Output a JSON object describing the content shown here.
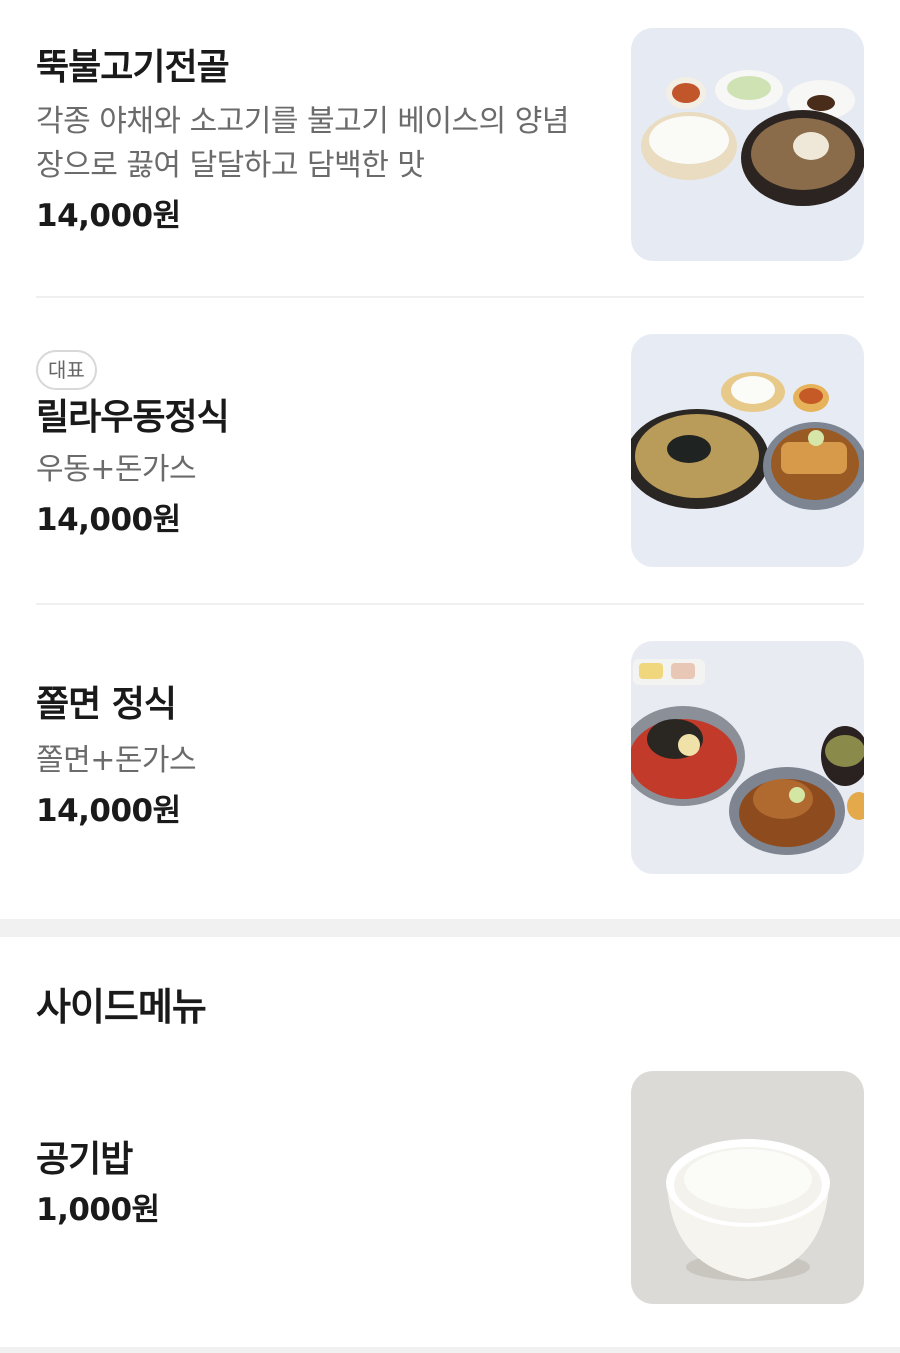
{
  "items": [
    {
      "name": "뚝불고기전골",
      "description_lines": [
        "각종 야채와 소고기를 불고기 베이스의 양념",
        "장으로 끓여 달달하고 담백한 맛"
      ],
      "price": "14,000원",
      "image_icon": "bulgogi-hotpot-photo"
    },
    {
      "badge": "대표",
      "name": "릴라우동정식",
      "description_lines": [
        "우동+돈가스"
      ],
      "price": "14,000원",
      "image_icon": "udon-set-photo"
    },
    {
      "name": "쫄면 정식",
      "description_lines": [
        "쫄면+돈가스"
      ],
      "price": "14,000원",
      "image_icon": "jjolmyeon-set-photo"
    }
  ],
  "side_section": {
    "title": "사이드메뉴",
    "items": [
      {
        "name": "공기밥",
        "price": "1,000원",
        "image_icon": "rice-bowl-photo"
      }
    ]
  },
  "colors": {
    "text": "#1a1a1a",
    "muted": "#6b6b6b",
    "divider": "#efefef",
    "section_gap": "#f1f1f1"
  }
}
